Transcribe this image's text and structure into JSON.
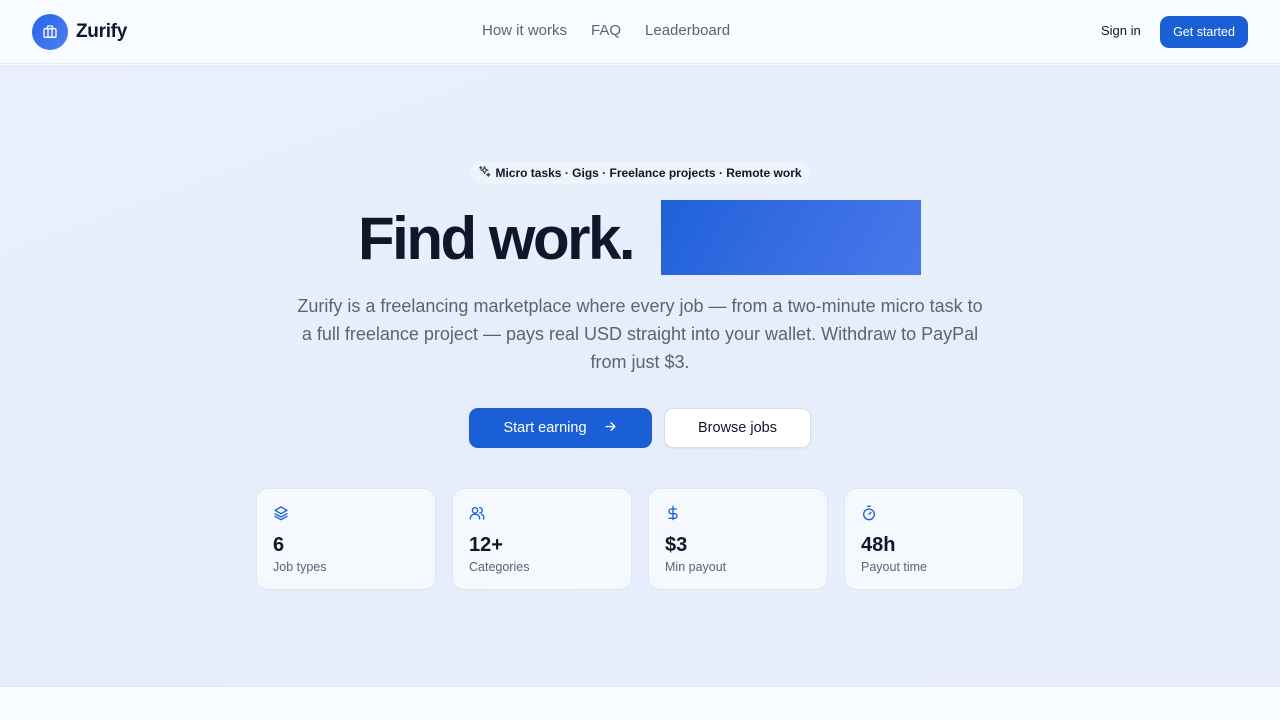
{
  "brand": {
    "name": "Zurify",
    "logo_icon": "briefcase-icon",
    "accent": "#1a5fd6"
  },
  "nav": {
    "items": [
      {
        "label": "How it works"
      },
      {
        "label": "FAQ"
      },
      {
        "label": "Leaderboard"
      }
    ],
    "signin_label": "Sign in",
    "get_started_label": "Get started"
  },
  "hero": {
    "tagline_icon": "sparkles-icon",
    "tagline": "Micro tasks · Gigs · Freelance projects · Remote work",
    "headline": "Find work.",
    "subtitle": "Zurify is a freelancing marketplace where every job — from a two-minute micro task to a full freelance project — pays real USD straight into your wallet. Withdraw to PayPal from just $3.",
    "primary_button": "Start earning",
    "secondary_button": "Browse jobs"
  },
  "stats": [
    {
      "icon": "layers-icon",
      "value": "6",
      "label": "Job types"
    },
    {
      "icon": "users-icon",
      "value": "12+",
      "label": "Categories"
    },
    {
      "icon": "dollar-icon",
      "value": "$3",
      "label": "Min payout"
    },
    {
      "icon": "timer-icon",
      "value": "48h",
      "label": "Payout time"
    }
  ]
}
